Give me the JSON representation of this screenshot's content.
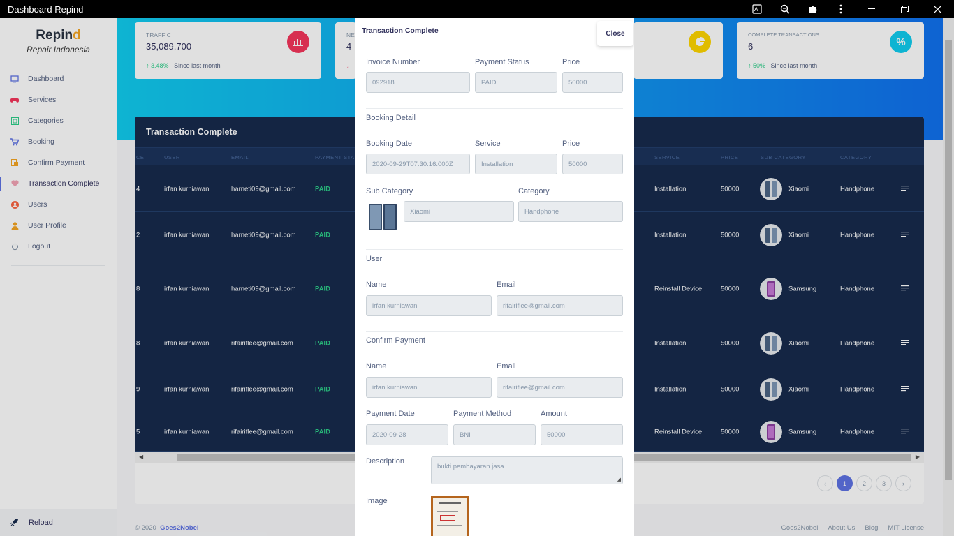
{
  "window": {
    "title": "Dashboard Repind"
  },
  "sidebar": {
    "brand_main": "Repin",
    "brand_accent": "d",
    "tagline": "Repair Indonesia",
    "items": [
      {
        "label": "Dashboard",
        "icon": "monitor-icon",
        "color": "#5e72e4"
      },
      {
        "label": "Services",
        "icon": "gamepad-icon",
        "color": "#f5365c"
      },
      {
        "label": "Categories",
        "icon": "grid-icon",
        "color": "#2dce89"
      },
      {
        "label": "Booking",
        "icon": "cart-icon",
        "color": "#5e72e4"
      },
      {
        "label": "Confirm Payment",
        "icon": "card-icon",
        "color": "#f5a623"
      },
      {
        "label": "Transaction Complete",
        "icon": "heart-icon",
        "color": "#f3a4b5"
      },
      {
        "label": "Users",
        "icon": "user-circle-icon",
        "color": "#fb6340"
      },
      {
        "label": "User Profile",
        "icon": "user-icon",
        "color": "#f5a623"
      },
      {
        "label": "Logout",
        "icon": "power-icon",
        "color": "#8898aa"
      }
    ],
    "reload_label": "Reload"
  },
  "stats": [
    {
      "label": "TRAFFIC",
      "value": "35,089,700",
      "delta": "3.48%",
      "delta_dir": "up",
      "since": "Since last month",
      "icon": "chart-bar-icon",
      "color": "#f5365c"
    },
    {
      "label": "NE",
      "value": "4",
      "delta": "",
      "delta_dir": "down",
      "since": "",
      "icon": "",
      "color": ""
    },
    {
      "label": "",
      "value": "",
      "delta": "",
      "delta_dir": "",
      "since": "",
      "icon": "pie-chart-icon",
      "color": "#ffd600"
    },
    {
      "label": "COMPLETE TRANSACTIONS",
      "value": "6",
      "delta": "50%",
      "delta_dir": "up",
      "since": "Since last month",
      "icon": "percent-icon",
      "color": "#11cdef"
    }
  ],
  "table": {
    "title": "Transaction Complete",
    "headers_left": [
      "CE",
      "USER",
      "EMAIL",
      "PAYMENT STAT"
    ],
    "headers_right": [
      "SERVICE",
      "PRICE",
      "SUB CATEGORY",
      "CATEGORY"
    ],
    "rows": [
      {
        "id": "4",
        "user": "irfan kurniawan",
        "email": "harneti09@gmail.com",
        "status": "PAID",
        "service": "Installation",
        "price": "50000",
        "sub": "Xiaomi",
        "cat": "Handphone"
      },
      {
        "id": "2",
        "user": "irfan kurniawan",
        "email": "harneti09@gmail.com",
        "status": "PAID",
        "service": "Installation",
        "price": "50000",
        "sub": "Xiaomi",
        "cat": "Handphone"
      },
      {
        "id": "8",
        "user": "irfan kurniawan",
        "email": "harneti09@gmail.com",
        "status": "PAID",
        "service": "Reinstall Device",
        "price": "50000",
        "sub": "Samsung",
        "cat": "Handphone"
      },
      {
        "id": "8",
        "user": "irfan kurniawan",
        "email": "rifairiflee@gmail.com",
        "status": "PAID",
        "service": "Installation",
        "price": "50000",
        "sub": "Xiaomi",
        "cat": "Handphone"
      },
      {
        "id": "9",
        "user": "irfan kurniawan",
        "email": "rifairiflee@gmail.com",
        "status": "PAID",
        "service": "Installation",
        "price": "50000",
        "sub": "Xiaomi",
        "cat": "Handphone"
      },
      {
        "id": "5",
        "user": "irfan kurniawan",
        "email": "rifairiflee@gmail.com",
        "status": "PAID",
        "service": "Reinstall Device",
        "price": "50000",
        "sub": "Samsung",
        "cat": "Handphone"
      }
    ],
    "pages": [
      "1",
      "2",
      "3"
    ],
    "current_page": "1"
  },
  "footer": {
    "copyright": "© 2020",
    "brand": "Goes2Nobel",
    "links": [
      "Goes2Nobel",
      "About Us",
      "Blog",
      "MIT License"
    ]
  },
  "modal": {
    "title": "Transaction Complete",
    "close_label": "Close",
    "invoice_label": "Invoice Number",
    "invoice_value": "092918",
    "status_label": "Payment Status",
    "status_value": "PAID",
    "price_label": "Price",
    "price_value": "50000",
    "booking_section": "Booking Detail",
    "booking_date_label": "Booking Date",
    "booking_date_value": "2020-09-29T07:30:16.000Z",
    "service_label": "Service",
    "service_value": "Installation",
    "booking_price_label": "Price",
    "booking_price_value": "50000",
    "subcat_label": "Sub Category",
    "subcat_value": "Xiaomi",
    "category_label": "Category",
    "category_value": "Handphone",
    "user_section": "User",
    "user_name_label": "Name",
    "user_name_value": "irfan kurniawan",
    "user_email_label": "Email",
    "user_email_value": "rifairiflee@gmail.com",
    "confirm_section": "Confirm Payment",
    "confirm_name_label": "Name",
    "confirm_name_value": "irfan kurniawan",
    "confirm_email_label": "Email",
    "confirm_email_value": "rifairiflee@gmail.com",
    "payment_date_label": "Payment Date",
    "payment_date_value": "2020-09-28",
    "payment_method_label": "Payment Method",
    "payment_method_value": "BNI",
    "amount_label": "Amount",
    "amount_value": "50000",
    "description_label": "Description",
    "description_value": "bukti pembayaran jasa",
    "image_label": "Image"
  }
}
